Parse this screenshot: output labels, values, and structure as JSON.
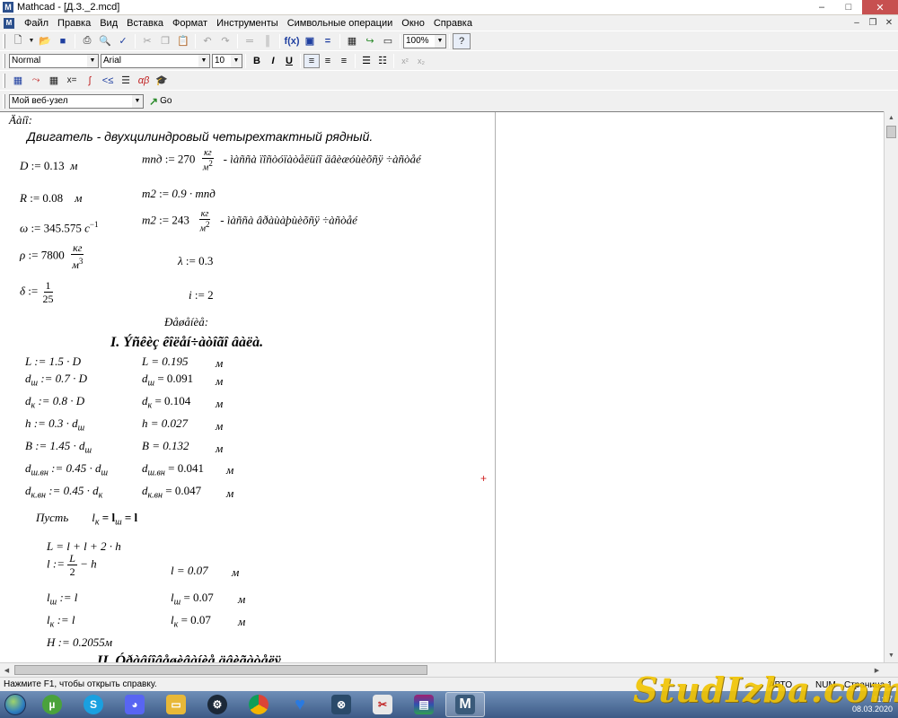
{
  "window": {
    "title": "Mathcad - [Д.З._2.mcd]",
    "app_icon": "M",
    "controls": [
      "minimize-icon",
      "maximize-icon",
      "close-icon"
    ]
  },
  "menu": {
    "items": [
      "Файл",
      "Правка",
      "Вид",
      "Вставка",
      "Формат",
      "Инструменты",
      "Символьные операции",
      "Окно",
      "Справка"
    ]
  },
  "toolbar": {
    "zoom": "100%",
    "style": "Normal",
    "font": "Arial",
    "font_size": "10",
    "bold": "B",
    "italic": "I",
    "underline": "U",
    "web_node": "Мой веб-узел",
    "go": "Go"
  },
  "doc": {
    "heading_given": "Äàíî:",
    "engine_title": "Двигатель - двухцилиндровый четырехтактный рядный.",
    "D": {
      "lhs": "D",
      "rhs": "0.13",
      "unit": "м"
    },
    "mpd": {
      "lhs": "mпд",
      "rhs": "270",
      "unit_num": "кг",
      "unit_den": "м",
      "unit_exp": "2",
      "comment": "- ìàññà ïîñòóïàòåëüíî äâèæóùèõñÿ ÷àñòåé"
    },
    "R": {
      "lhs": "R",
      "rhs": "0.08",
      "unit": "м"
    },
    "m2a": {
      "lhs": "m2",
      "rhs": "0.9 · mпд"
    },
    "omega": {
      "lhs": "ω",
      "rhs": "345.575",
      "unit": "с",
      "exp": "−1"
    },
    "m2b": {
      "lhs": "m2",
      "rhs": "243",
      "unit_num": "кг",
      "unit_den": "м",
      "unit_exp": "2",
      "comment": "- ìàññà âðàùàþùèõñÿ ÷àñòåé"
    },
    "rho": {
      "lhs": "ρ",
      "rhs": "7800",
      "unit_num": "кг",
      "unit_den": "м",
      "unit_exp": "3"
    },
    "lambda": {
      "lhs": "λ",
      "rhs": "0.3"
    },
    "delta": {
      "lhs": "δ",
      "num": "1",
      "den": "25"
    },
    "i": {
      "lhs": "i",
      "rhs": "2"
    },
    "heading_solution": "Ðåøåíèå:",
    "section1": "I. Ýñêèç êîëåí÷àòîãî âàëà.",
    "rows": [
      {
        "def": "L := 1.5 · D",
        "res": "L = 0.195",
        "unit": "м"
      },
      {
        "def_base": "d",
        "def_sub": "ш",
        "def_tail": " := 0.7 · D",
        "res_base": "d",
        "res_sub": "ш",
        "res_tail": " = 0.091",
        "unit": "м"
      },
      {
        "def_base": "d",
        "def_sub": "к",
        "def_tail": " := 0.8 · D",
        "res_base": "d",
        "res_sub": "к",
        "res_tail": " = 0.104",
        "unit": "м"
      },
      {
        "def": "h := 0.3 · d",
        "def_sub2": "ш",
        "res": "h = 0.027",
        "unit": "м"
      },
      {
        "def": "B := 1.45 · d",
        "def_sub2": "ш",
        "res": "B = 0.132",
        "unit": "м"
      },
      {
        "def_base": "d",
        "def_sub": "ш.вн",
        "def_tail": " := 0.45 · d",
        "def_sub2": "ш",
        "res_base": "d",
        "res_sub": "ш.вн",
        "res_tail": " = 0.041",
        "unit": "м"
      },
      {
        "def_base": "d",
        "def_sub": "к.вн",
        "def_tail": " := 0.45 · d",
        "def_sub2": "к",
        "res_base": "d",
        "res_sub": "к.вн",
        "res_tail": " = 0.047",
        "unit": "м"
      }
    ],
    "let_word": "Пусть",
    "let_expr_a": "l",
    "let_sub_a": "к",
    "let_expr_b": " = l",
    "let_sub_b": "ш",
    "let_expr_c": " = l",
    "L_expr": "L = l + l + 2 · h",
    "l_def_lhs": "l :=",
    "l_def_num": "L",
    "l_def_den": "2",
    "l_def_tail": "− h",
    "l_res": "l = 0.07",
    "lsh_def": "l",
    "lsh_def_sub": "ш",
    "lsh_def_tail": " := l",
    "lsh_res": "l",
    "lsh_res_sub": "ш",
    "lsh_res_tail": " = 0.07",
    "lk_def": "l",
    "lk_def_sub": "к",
    "lk_def_tail": " := l",
    "lk_res": "l",
    "lk_res_sub": "к",
    "lk_res_tail": " = 0.07",
    "H_def": "H := 0.2055м",
    "section2": "II. Óðàâíîâåøèâàíèå äâèãàòåëÿ",
    "unit_m": "м"
  },
  "statusbar": {
    "hint": "Нажмите F1, чтобы открыть справку.",
    "mode": "АВТО",
    "num": "NUM",
    "page": "Страница 1"
  },
  "tray": {
    "time": "11:17",
    "date": "08.03.2020"
  },
  "watermark": "StudIzba.com"
}
